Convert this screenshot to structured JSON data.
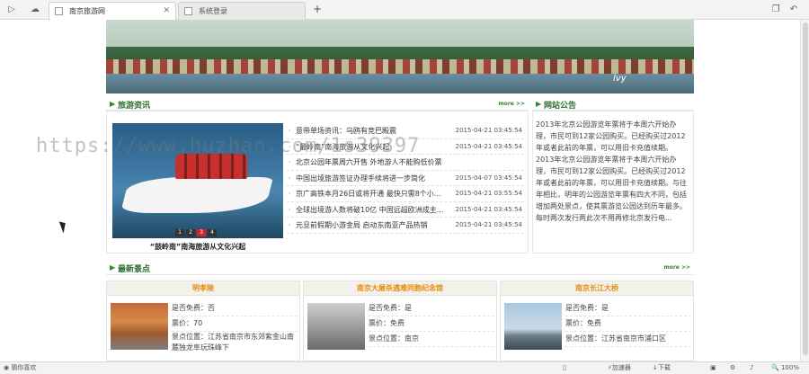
{
  "browser": {
    "tabs": [
      {
        "label": "南京旅游网",
        "active": true
      },
      {
        "label": "系统登录",
        "active": false
      }
    ],
    "status_left": "猜你喜欢",
    "status_accelerator": "加速器",
    "status_download": "下载",
    "status_zoom": "100%"
  },
  "banner": {
    "logo_text": "lvy"
  },
  "travel_news": {
    "title": "旅游资讯",
    "more": "more >>",
    "photo_caption": "“鼓岭南”南海旅游从文化兴起",
    "photo_dots": [
      "1",
      "2",
      "3",
      "4"
    ],
    "items": [
      {
        "title": "意带单场资讯：乌鸥有竞巴殿震",
        "date": "2015-04-21 03:45:54"
      },
      {
        "title": "“最岭南”南海旅游从文化兴起",
        "date": "2015-04-21 03:45:54"
      },
      {
        "title": "北京公园年票周六开售 外地游人不能购低价票",
        "date": ""
      },
      {
        "title": "中国出境旅游签证办理手续将进一步简化",
        "date": "2015-04-07 03:45:54"
      },
      {
        "title": "京广高铁本月26日或将开通 最快只需8个小...",
        "date": "2015-04-21 03:55:54"
      },
      {
        "title": "全球出境游人数将破10亿 中国远超欧洲成主...",
        "date": "2015-04-21 03:45:54"
      },
      {
        "title": "元旦前假期小游金局 启动东南亚产品热销",
        "date": "2015-04-21 03:45:54"
      }
    ]
  },
  "notice": {
    "title": "网站公告",
    "text": "2013年北京公园游览年票将于本周六开始办理，市民可到12家公园购买。已经购买过2012年或者此前的年票，可以用旧卡充值续期。 2013年北京公园游览年票将于本周六开始办理，市民可到12家公园购买。已经购买过2012年或者此前的年票，可以用旧卡充值续期。与往年相比，明年的公园游览年票有四大不同，包括增加两处景点，使其票游览公园达到历年最多。每时两次发行两此次不用再修北京发行电..."
  },
  "scenic": {
    "title": "最新景点",
    "more": "more >>",
    "cards": [
      {
        "name": "明孝陵",
        "free_label": "是否免费：否",
        "price_label": "票价：70",
        "location_label": "景点位置：江苏省南京市东郊紫金山南麓独龙阜玩珠峰下",
        "img": "autumn"
      },
      {
        "name": "南京大屠杀遇难同胞纪念馆",
        "free_label": "是否免费：是",
        "price_label": "票价：免费",
        "location_label": "景点位置：南京",
        "img": "stone"
      },
      {
        "name": "南京长江大桥",
        "free_label": "是否免费：是",
        "price_label": "票价：免费",
        "location_label": "景点位置：江苏省南京市浦口区",
        "img": "bridge"
      }
    ]
  },
  "watermark": "https://www.huzhan.com/1s39397"
}
